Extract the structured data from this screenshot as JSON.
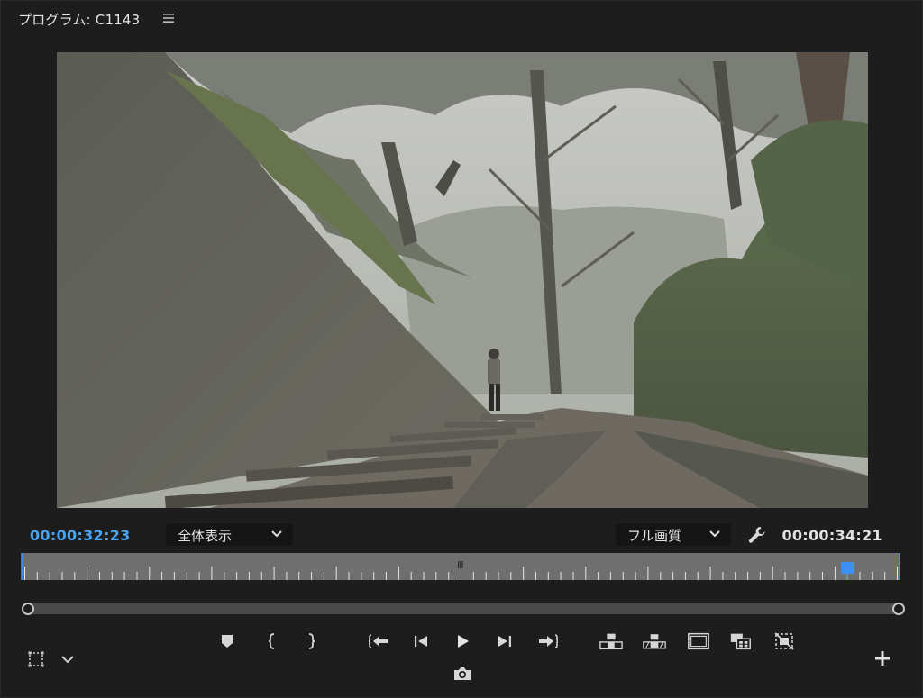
{
  "panel": {
    "title": "プログラム: C1143"
  },
  "timecode": {
    "current": "00:00:32:23",
    "duration": "00:00:34:21"
  },
  "zoom_dropdown": {
    "selected": "全体表示"
  },
  "quality_dropdown": {
    "selected": "フル画質"
  },
  "ruler": {
    "playhead_position": 0.94,
    "midpoint_glyph": "Ⅲ"
  },
  "colors": {
    "accent": "#4aa3f0",
    "playhead": "#3d8ff5",
    "panel_bg": "#1d1d1d"
  },
  "icons": {
    "menu": "hamburger-icon",
    "wrench": "wrench-icon",
    "settings": "safe-margins-icon",
    "add": "plus-icon"
  }
}
